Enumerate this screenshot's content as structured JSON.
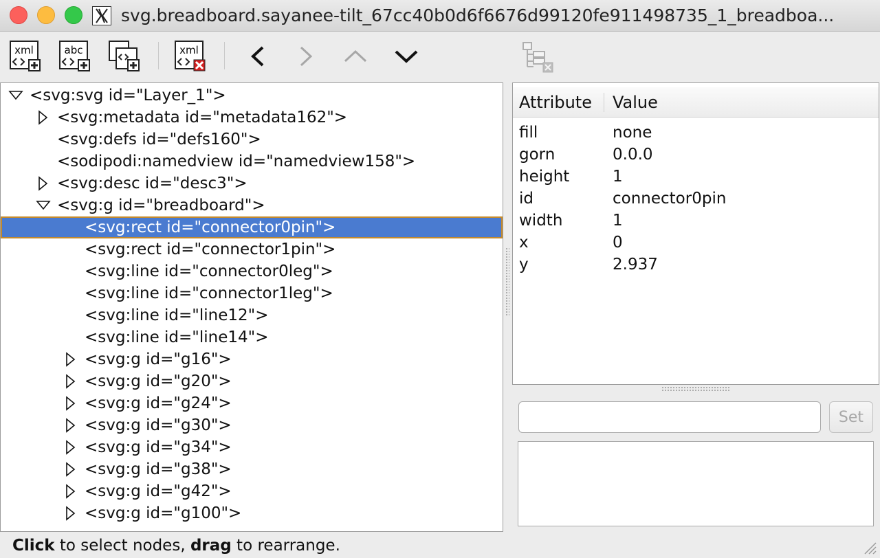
{
  "window": {
    "title": "svg.breadboard.sayanee-tilt_67cc40b0d6f6676d99120fe911498735_1_breadboa..."
  },
  "toolbar": {
    "new_element_icon_text": "xml",
    "new_text_icon_text": "abc",
    "delete_icon_text": "xml"
  },
  "tree": {
    "nodes": [
      {
        "label": "<svg:svg id=\"Layer_1\">",
        "expander": "expanded"
      },
      {
        "label": "<svg:metadata id=\"metadata162\">",
        "expander": "collapsed"
      },
      {
        "label": "<svg:defs id=\"defs160\">",
        "expander": "none"
      },
      {
        "label": "<sodipodi:namedview id=\"namedview158\">",
        "expander": "none"
      },
      {
        "label": "<svg:desc id=\"desc3\">",
        "expander": "collapsed"
      },
      {
        "label": "<svg:g id=\"breadboard\">",
        "expander": "expanded"
      },
      {
        "label": "<svg:rect id=\"connector0pin\">",
        "expander": "none",
        "selected": true
      },
      {
        "label": "<svg:rect id=\"connector1pin\">",
        "expander": "none"
      },
      {
        "label": "<svg:line id=\"connector0leg\">",
        "expander": "none"
      },
      {
        "label": "<svg:line id=\"connector1leg\">",
        "expander": "none"
      },
      {
        "label": "<svg:line id=\"line12\">",
        "expander": "none"
      },
      {
        "label": "<svg:line id=\"line14\">",
        "expander": "none"
      },
      {
        "label": "<svg:g id=\"g16\">",
        "expander": "collapsed"
      },
      {
        "label": "<svg:g id=\"g20\">",
        "expander": "collapsed"
      },
      {
        "label": "<svg:g id=\"g24\">",
        "expander": "collapsed"
      },
      {
        "label": "<svg:g id=\"g30\">",
        "expander": "collapsed"
      },
      {
        "label": "<svg:g id=\"g34\">",
        "expander": "collapsed"
      },
      {
        "label": "<svg:g id=\"g38\">",
        "expander": "collapsed"
      },
      {
        "label": "<svg:g id=\"g42\">",
        "expander": "collapsed"
      },
      {
        "label": "<svg:g id=\"g100\">",
        "expander": "collapsed"
      }
    ]
  },
  "attributes": {
    "header_attribute": "Attribute",
    "header_value": "Value",
    "rows": [
      {
        "name": "fill",
        "value": "none"
      },
      {
        "name": "gorn",
        "value": "0.0.0"
      },
      {
        "name": "height",
        "value": "1"
      },
      {
        "name": "id",
        "value": "connector0pin"
      },
      {
        "name": "width",
        "value": "1"
      },
      {
        "name": "x",
        "value": "0"
      },
      {
        "name": "y",
        "value": "2.937"
      }
    ]
  },
  "editor": {
    "value_input": "",
    "set_label": "Set",
    "textarea_value": ""
  },
  "status": {
    "click_word": "Click",
    "middle_text": " to select nodes, ",
    "drag_word": "drag",
    "end_text": " to rearrange."
  },
  "colors": {
    "selection": "#4a7bd0",
    "selection_outline": "#c48a2d"
  }
}
